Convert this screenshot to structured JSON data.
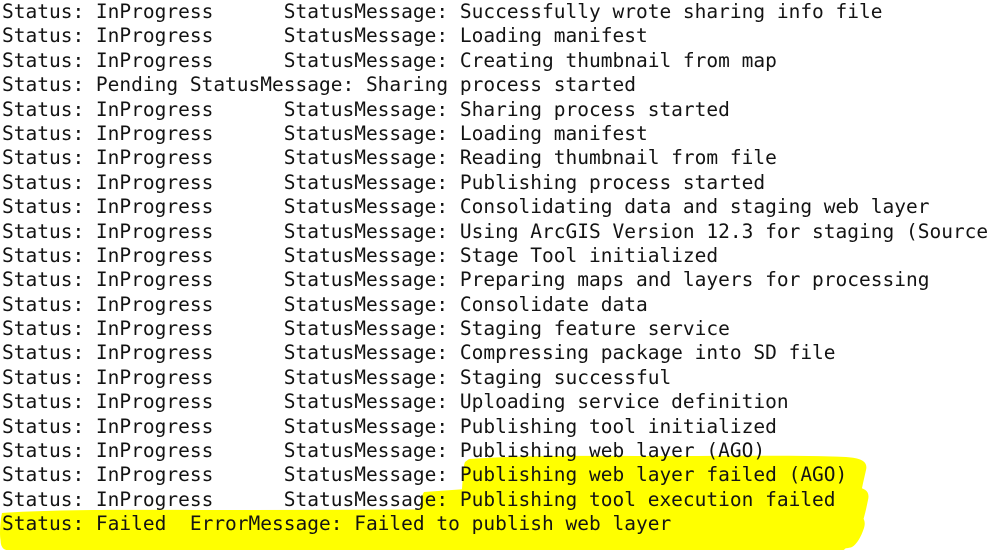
{
  "log": {
    "status_label": "Status:",
    "status_message_label": "StatusMessage:",
    "error_message_label": "ErrorMessage:",
    "colors": {
      "text": "#131313",
      "background": "#ffffff",
      "highlight": "#ffff00"
    },
    "lines": [
      {
        "text": "Status: InProgress      StatusMessage: Successfully wrote sharing info file",
        "status": "InProgress",
        "message": "Successfully wrote sharing info file",
        "highlighted": false
      },
      {
        "text": "Status: InProgress      StatusMessage: Loading manifest",
        "status": "InProgress",
        "message": "Loading manifest",
        "highlighted": false
      },
      {
        "text": "Status: InProgress      StatusMessage: Creating thumbnail from map",
        "status": "InProgress",
        "message": "Creating thumbnail from map",
        "highlighted": false
      },
      {
        "text": "Status: Pending StatusMessage: Sharing process started",
        "status": "Pending",
        "message": "Sharing process started",
        "highlighted": false
      },
      {
        "text": "Status: InProgress      StatusMessage: Sharing process started",
        "status": "InProgress",
        "message": "Sharing process started",
        "highlighted": false
      },
      {
        "text": "Status: InProgress      StatusMessage: Loading manifest",
        "status": "InProgress",
        "message": "Loading manifest",
        "highlighted": false
      },
      {
        "text": "Status: InProgress      StatusMessage: Reading thumbnail from file",
        "status": "InProgress",
        "message": "Reading thumbnail from file",
        "highlighted": false
      },
      {
        "text": "Status: InProgress      StatusMessage: Publishing process started",
        "status": "InProgress",
        "message": "Publishing process started",
        "highlighted": false
      },
      {
        "text": "Status: InProgress      StatusMessage: Consolidating data and staging web layer",
        "status": "InProgress",
        "message": "Consolidating data and staging web layer",
        "highlighted": false
      },
      {
        "text": "Status: InProgress      StatusMessage: Using ArcGIS Version 12.3 for staging (Source",
        "status": "InProgress",
        "message": "Using ArcGIS Version 12.3 for staging (Source",
        "highlighted": false,
        "truncated": true
      },
      {
        "text": "Status: InProgress      StatusMessage: Stage Tool initialized",
        "status": "InProgress",
        "message": "Stage Tool initialized",
        "highlighted": false
      },
      {
        "text": "Status: InProgress      StatusMessage: Preparing maps and layers for processing",
        "status": "InProgress",
        "message": "Preparing maps and layers for processing",
        "highlighted": false
      },
      {
        "text": "Status: InProgress      StatusMessage: Consolidate data",
        "status": "InProgress",
        "message": "Consolidate data",
        "highlighted": false
      },
      {
        "text": "Status: InProgress      StatusMessage: Staging feature service",
        "status": "InProgress",
        "message": "Staging feature service",
        "highlighted": false
      },
      {
        "text": "Status: InProgress      StatusMessage: Compressing package into SD file",
        "status": "InProgress",
        "message": "Compressing package into SD file",
        "highlighted": false
      },
      {
        "text": "Status: InProgress      StatusMessage: Staging successful",
        "status": "InProgress",
        "message": "Staging successful",
        "highlighted": false
      },
      {
        "text": "Status: InProgress      StatusMessage: Uploading service definition",
        "status": "InProgress",
        "message": "Uploading service definition",
        "highlighted": false
      },
      {
        "text": "Status: InProgress      StatusMessage: Publishing tool initialized",
        "status": "InProgress",
        "message": "Publishing tool initialized",
        "highlighted": false
      },
      {
        "text": "Status: InProgress      StatusMessage: Publishing web layer (AGO)",
        "status": "InProgress",
        "message": "Publishing web layer (AGO)",
        "highlighted": false
      },
      {
        "text": "Status: InProgress      StatusMessage: Publishing web layer failed (AGO)",
        "status": "InProgress",
        "message": "Publishing web layer failed (AGO)",
        "highlighted": true
      },
      {
        "text": "Status: InProgress      StatusMessage: Publishing tool execution failed",
        "status": "InProgress",
        "message": "Publishing tool execution failed",
        "highlighted": true
      },
      {
        "text": "Status: Failed  ErrorMessage: Failed to publish web layer",
        "status": "Failed",
        "message": "Failed to publish web layer",
        "highlighted": true
      }
    ]
  }
}
